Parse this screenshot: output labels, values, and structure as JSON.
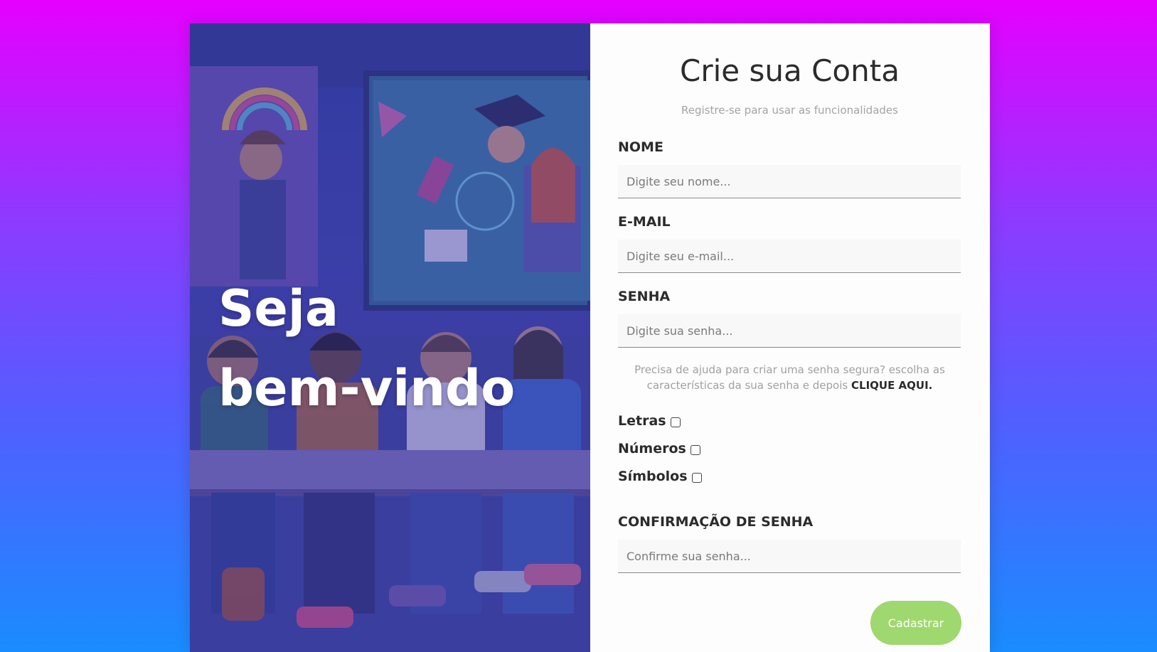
{
  "hero": {
    "title_line1": "Seja",
    "title_line2": "bem-vindo"
  },
  "form": {
    "title": "Crie sua Conta",
    "subtitle": "Registre-se para usar as funcionalidades",
    "name": {
      "label": "NOME",
      "placeholder": "Digite seu nome..."
    },
    "email": {
      "label": "E-MAIL",
      "placeholder": "Digite seu e-mail..."
    },
    "password": {
      "label": "SENHA",
      "placeholder": "Digite sua senha..."
    },
    "help_text": "Precisa de ajuda para criar uma senha segura? escolha as características da sua senha e depois",
    "help_link": "CLIQUE AQUI.",
    "options": [
      {
        "label": "Letras"
      },
      {
        "label": "Números"
      },
      {
        "label": "Símbolos"
      }
    ],
    "confirm": {
      "label": "CONFIRMAÇÃO DE SENHA",
      "placeholder": "Confirme sua senha..."
    },
    "submit_label": "Cadastrar"
  },
  "colors": {
    "background_top": "#e600ff",
    "background_bottom": "#1a8cff",
    "button": "#9fd86e",
    "hero_overlay": "#3b3fa8"
  }
}
